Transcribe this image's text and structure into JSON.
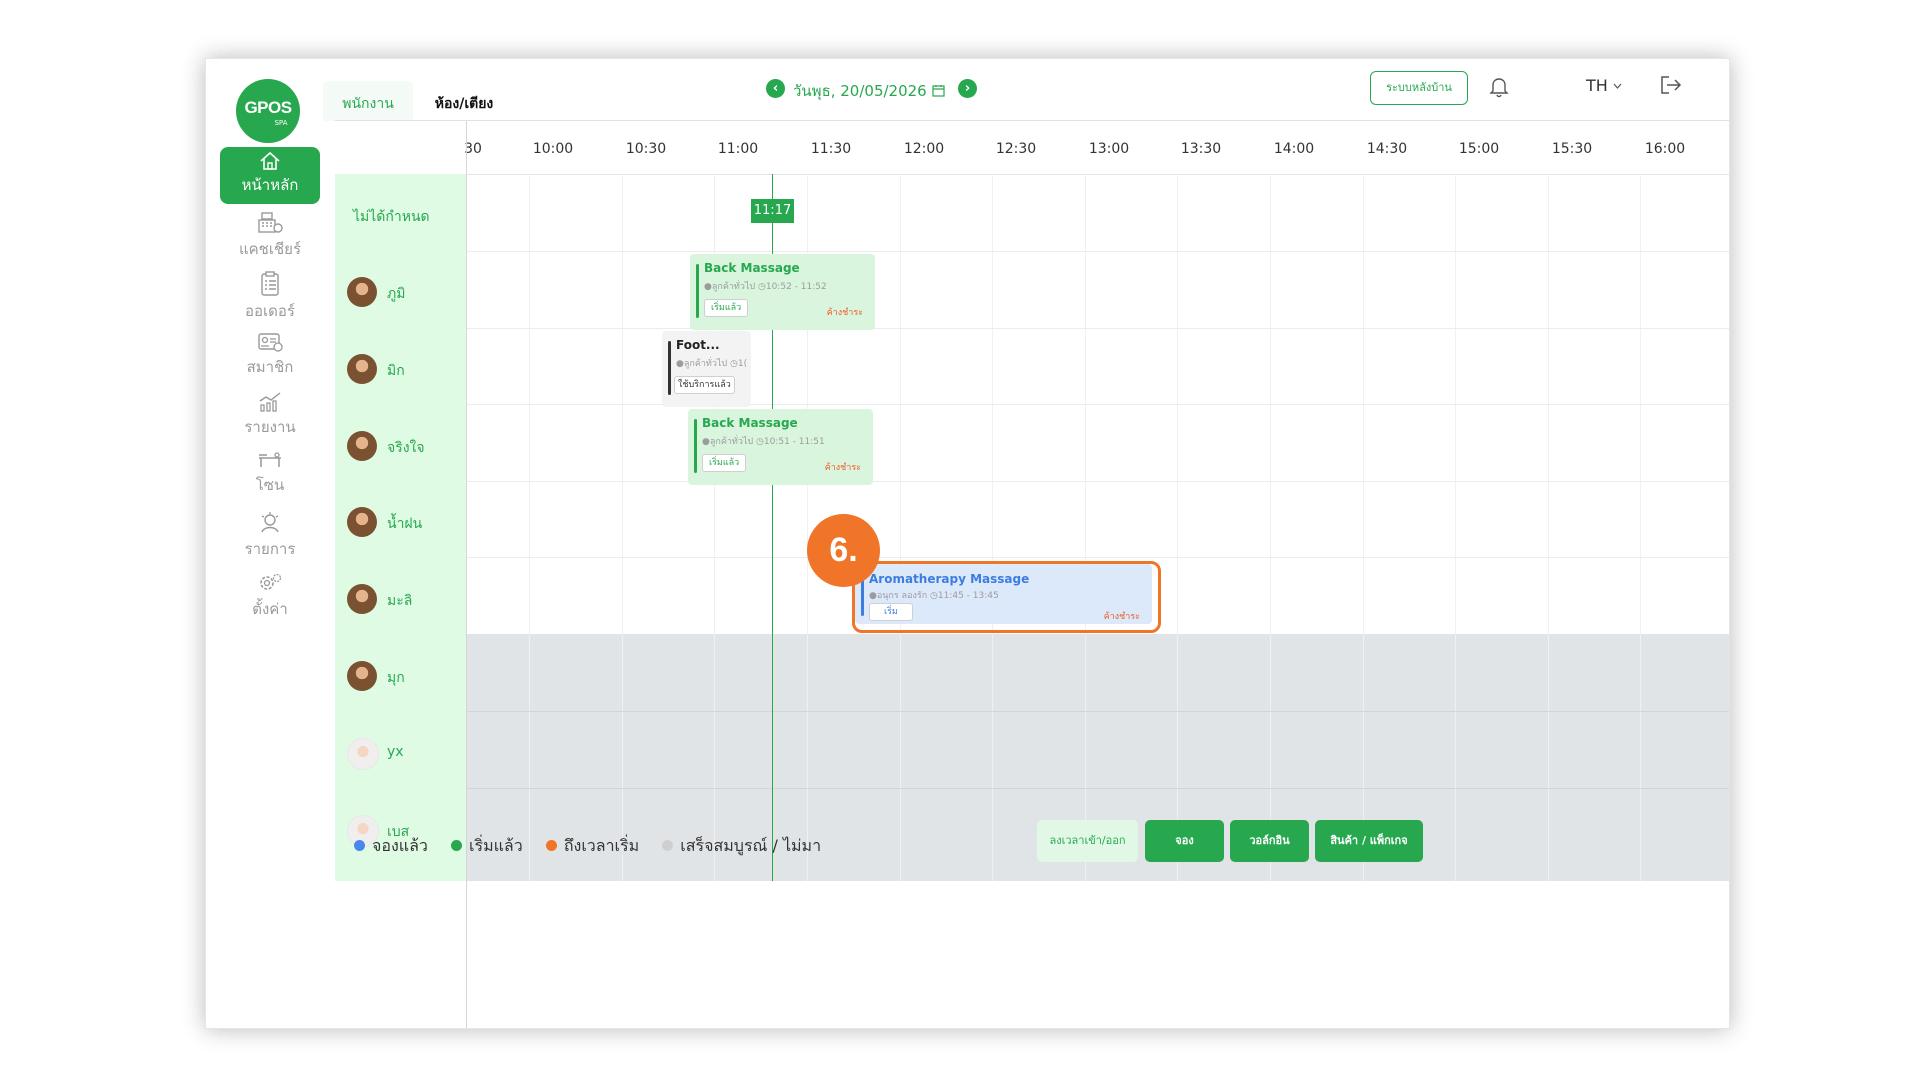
{
  "app": {
    "logo_main": "GPOS",
    "logo_sub": "SPA"
  },
  "sidebar": {
    "items": [
      {
        "label": "หน้าหลัก",
        "icon": "home-icon",
        "active": true
      },
      {
        "label": "แคชเชียร์",
        "icon": "cashier-icon",
        "active": false
      },
      {
        "label": "ออเดอร์",
        "icon": "clipboard-icon",
        "active": false
      },
      {
        "label": "สมาชิก",
        "icon": "member-card-icon",
        "active": false
      },
      {
        "label": "รายงาน",
        "icon": "report-chart-icon",
        "active": false
      },
      {
        "label": "โซน",
        "icon": "massage-bed-icon",
        "active": false
      },
      {
        "label": "รายการ",
        "icon": "service-list-icon",
        "active": false
      },
      {
        "label": "ตั้งค่า",
        "icon": "gear-icon",
        "active": false
      }
    ]
  },
  "tabs": [
    {
      "label": "พนักงาน",
      "active": true
    },
    {
      "label": "ห้อง/เตียง",
      "active": false
    }
  ],
  "header": {
    "date": "วันพุธ, 20/05/2026",
    "backoffice_button": "ระบบหลังบ้าน",
    "language": "TH"
  },
  "timeline": {
    "ticks": [
      "30",
      "10:00",
      "10:30",
      "11:00",
      "11:30",
      "12:00",
      "12:30",
      "13:00",
      "13:30",
      "14:00",
      "14:30",
      "15:00",
      "15:30",
      "16:00"
    ],
    "now": "11:17",
    "unassigned_label": "ไม่ได้กำหนด"
  },
  "staff": [
    {
      "name": "ภูมิ"
    },
    {
      "name": "มิก"
    },
    {
      "name": "จริงใจ"
    },
    {
      "name": "น้ำฝน"
    },
    {
      "name": "มะลิ"
    },
    {
      "name": "มุก"
    },
    {
      "name": "yx"
    },
    {
      "name": "เบส"
    }
  ],
  "bookings": [
    {
      "title": "Back Massage",
      "customer": "●ลูกค้าทั่วไป",
      "time": "10:52 - 11:52",
      "state": "เริ่มแล้ว",
      "due": "ค้างชำระ"
    },
    {
      "title": "Foot...",
      "customer": "●ลูกค้าทั่วไป",
      "time": "1(",
      "state": "ใช้บริการแล้ว",
      "due": ""
    },
    {
      "title": "Back Massage",
      "customer": "●ลูกค้าทั่วไป",
      "time": "10:51 - 11:51",
      "state": "เริ่มแล้ว",
      "due": "ค้างชำระ"
    },
    {
      "title": "Aromatherapy Massage",
      "customer": "●อนุกร ลองรัก",
      "time": "11:45 - 13:45",
      "state": "เริ่ม",
      "due": "ค้างชำระ"
    }
  ],
  "step_badge": "6.",
  "legend": [
    {
      "label": "จองแล้ว",
      "color": "#4a87ec"
    },
    {
      "label": "เริ่มแล้ว",
      "color": "#27a84f"
    },
    {
      "label": "ถึงเวลาเริ่ม",
      "color": "#f07528"
    },
    {
      "label": "เสร็จสมบูรณ์ / ไม่มา",
      "color": "#cfcfcf"
    }
  ],
  "footer_buttons": {
    "clock": "ลงเวลาเข้า/ออก",
    "book": "จอง",
    "walkin": "วอล์กอิน",
    "products": "สินค้า / แพ็กเกจ"
  },
  "colors": {
    "brand_green": "#27a84f",
    "highlight_orange": "#f07528",
    "booked_blue": "#3d7de0",
    "due_red": "#f05a24"
  }
}
